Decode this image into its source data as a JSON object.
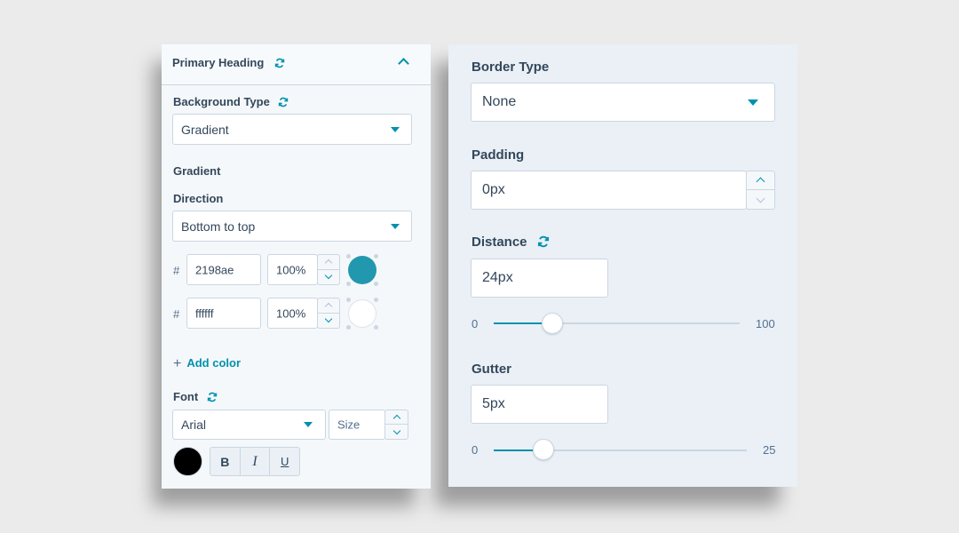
{
  "left_panel": {
    "section_title": "Primary Heading",
    "background_type": {
      "label": "Background Type",
      "value": "Gradient"
    },
    "gradient_heading": "Gradient",
    "direction": {
      "label": "Direction",
      "value": "Bottom to top"
    },
    "colors": [
      {
        "hash": "#",
        "hex": "2198ae",
        "opacity": "100%",
        "swatch": "#2198ae"
      },
      {
        "hash": "#",
        "hex": "ffffff",
        "opacity": "100%",
        "swatch": "#ffffff"
      }
    ],
    "add_color_label": "Add color",
    "font": {
      "label": "Font",
      "family": "Arial",
      "size_placeholder": "Size",
      "color": "#000000"
    },
    "format_buttons": {
      "bold": "B",
      "italic": "I",
      "underline": "U"
    }
  },
  "right_panel": {
    "border_type": {
      "label": "Border Type",
      "value": "None"
    },
    "padding": {
      "label": "Padding",
      "value": "0px"
    },
    "distance": {
      "label": "Distance",
      "value": "24px",
      "slider_min": "0",
      "slider_max": "100",
      "slider_value": 24
    },
    "gutter": {
      "label": "Gutter",
      "value": "5px",
      "slider_min": "0",
      "slider_max": "25",
      "slider_value": 5
    }
  },
  "colors": {
    "accent": "#0091ae",
    "text": "#33475b",
    "border": "#cbd6e2"
  },
  "icons": [
    "sync-icon",
    "chevron-up-icon",
    "caret-down-icon",
    "plus-icon"
  ]
}
